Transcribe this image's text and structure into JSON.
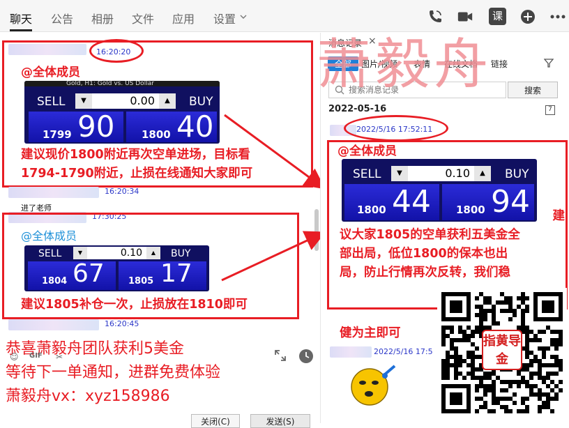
{
  "top_tabs": [
    "聊天",
    "公告",
    "相册",
    "文件",
    "应用",
    "设置"
  ],
  "top_icons": [
    "phone-icon",
    "video-icon",
    "class-icon",
    "add-icon",
    "more-icon"
  ],
  "top_class_label": "课",
  "chat": {
    "messages": [
      {
        "timestamp": "16:20:20",
        "mention": "@全体成员",
        "widget": {
          "header": "Gold, H1:  Gold vs. US Dollar",
          "sell_label": "SELL",
          "buy_label": "BUY",
          "lot": "0.00",
          "sell_small": "1799",
          "sell_big": "90",
          "buy_small": "1800",
          "buy_big": "40"
        },
        "text_lines": [
          "建议现价1800附近再次空单进场，目标看",
          "1794-1790附近，止损在线通知大家即可"
        ]
      },
      {
        "timestamp": "16:20:34"
      },
      {
        "text": "进了老师",
        "timestamp": "17:30:25"
      },
      {
        "mention": "@全体成员",
        "widget": {
          "sell_label": "SELL",
          "buy_label": "BUY",
          "lot": "0.10",
          "sell_small": "1804",
          "sell_big": "67",
          "buy_small": "1805",
          "buy_big": "17"
        },
        "text_lines": [
          "建议1805补仓一次，止损放在1810即可"
        ]
      },
      {
        "timestamp": "16:20:45"
      }
    ]
  },
  "promo_lines": [
    "恭喜萧毅舟团队获利5美金",
    "等待下一单通知，进群免费体验",
    "萧毅舟vx：xyz158986"
  ],
  "toolbar": {
    "close_label": "关闭(C)",
    "send_label": "发送(S)",
    "gif_label": "GIF"
  },
  "history": {
    "title": "消息记录",
    "close": "×",
    "tabs": [
      "全部",
      "图片/视频",
      "表情",
      "在线文档",
      "链接"
    ],
    "search_placeholder": "搜索消息记录",
    "search_button": "搜索",
    "date": "2022-05-16",
    "message": {
      "timestamp": "2022/5/16 17:52:11",
      "mention": "@全体成员",
      "widget": {
        "sell_label": "SELL",
        "buy_label": "BUY",
        "lot": "0.10",
        "sell_small": "1800",
        "sell_big": "44",
        "buy_small": "1800",
        "buy_big": "94"
      },
      "text_lines": [
        "建",
        "议大家1805的空单获利五美金全",
        "部出局，低位1800的保本也出",
        "局，防止行情再次反转，我们稳",
        "健为主即可"
      ]
    },
    "next_timestamp": "2022/5/16 17:5",
    "calendar_day": "7"
  },
  "watermark": "萧毅舟",
  "qr_seal": "指黄导金",
  "colors": {
    "red": "#e81d24",
    "blue_ts": "#2a36c8",
    "tab_blue": "#1e7fd8",
    "widget_blue": "#1818c0"
  }
}
